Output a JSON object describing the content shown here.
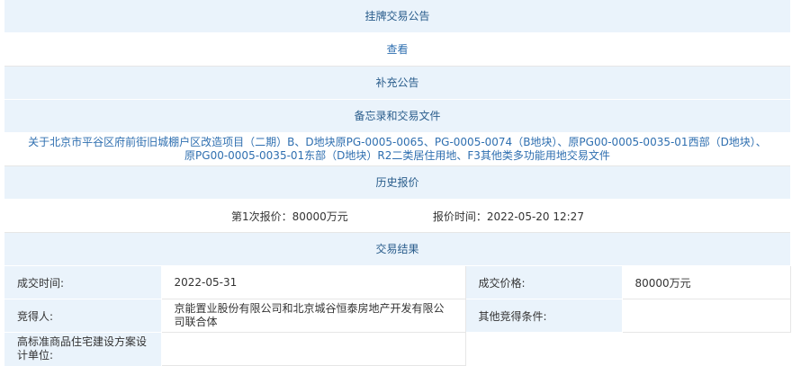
{
  "sections": {
    "listing_notice": "挂牌交易公告",
    "view": "查看",
    "supplement": "补充公告",
    "memo_docs": "备忘录和交易文件",
    "bid_history": "历史报价",
    "result": "交易结果"
  },
  "memo_doc_link": {
    "line1": "关于北京市平谷区府前街旧城棚户区改造项目（二期）B、D地块原PG-0005-0065、PG-0005-0074（B地块）、原PG00-0005-0035-01西部（D地块）、",
    "line2": "原PG00-0005-0035-01东部（D地块）R2二类居住用地、F3其他类多功能用地交易文件"
  },
  "bid": {
    "offer": "第1次报价：80000万元",
    "time": "报价时间：2022-05-20 12:27"
  },
  "result": {
    "deal_time_label": "成交时间:",
    "deal_time": "2022-05-31",
    "deal_price_label": "成交价格:",
    "deal_price": "80000万元",
    "winner_label": "竞得人:",
    "winner": "京能置业股份有限公司和北京城谷恒泰房地产开发有限公司联合体",
    "other_cond_label": "其他竞得条件:",
    "other_cond": "",
    "design_unit_label": "高标准商品住宅建设方案设计单位:",
    "design_unit": ""
  },
  "colors": {
    "header_bg": "#eaf3fb",
    "header_text": "#2a5d8c",
    "link": "#2f6fb0"
  }
}
